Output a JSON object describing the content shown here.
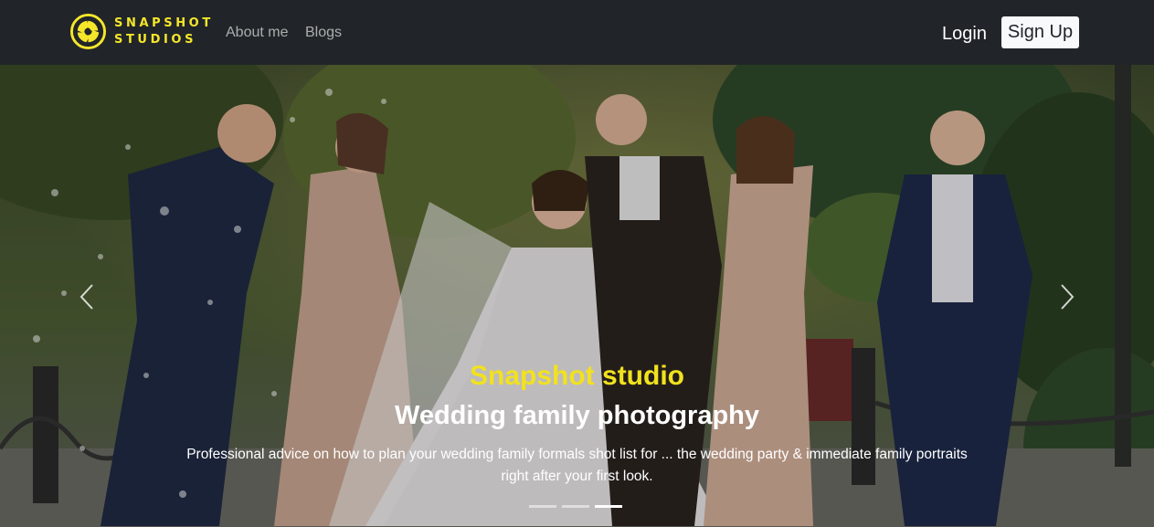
{
  "brand": {
    "line1": "SNAPSHOT",
    "line2": "STUDIOS",
    "logo_color": "#f5e62a"
  },
  "nav": {
    "links": [
      {
        "label": "About me"
      },
      {
        "label": "Blogs"
      }
    ],
    "login_label": "Login",
    "signup_label": "Sign Up"
  },
  "carousel": {
    "title": "Snapshot studio",
    "subtitle": "Wedding family photography",
    "text": "Professional advice on how to plan your wedding family formals shot list for ... the wedding party & immediate family portraits right after your first look.",
    "slide_count": 3,
    "active_index": 2,
    "title_color": "#f1e21d",
    "prev_icon": "chevron-left-icon",
    "next_icon": "chevron-right-icon"
  },
  "colors": {
    "navbar_bg": "#212529",
    "accent": "#f1e21d"
  }
}
